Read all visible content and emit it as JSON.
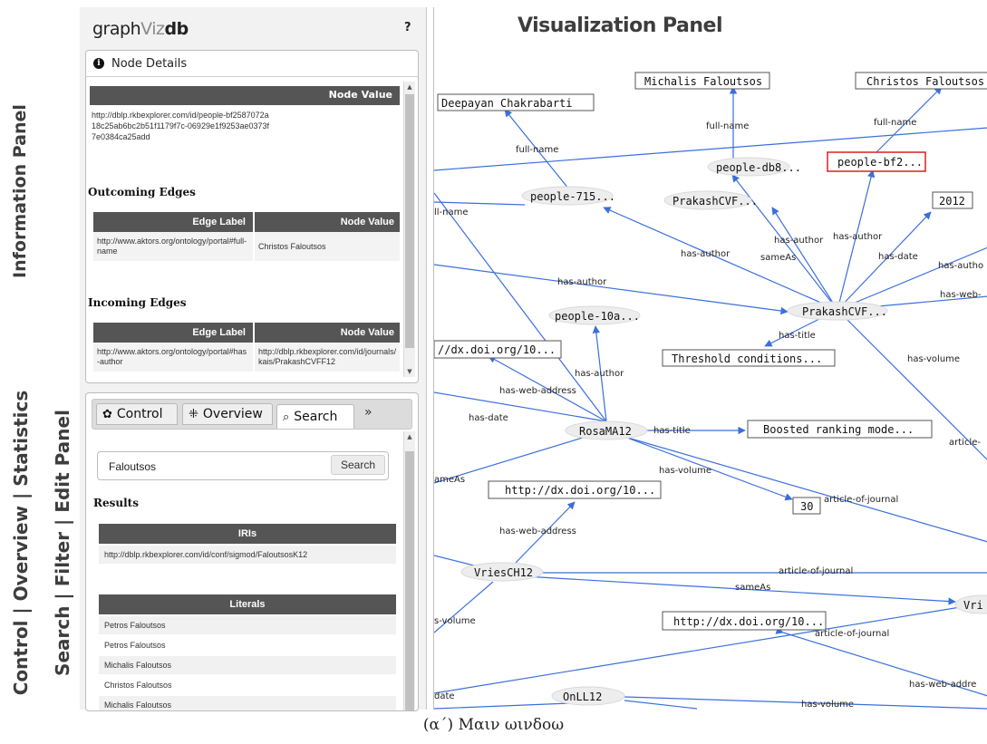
{
  "side_labels": {
    "information": "Information Panel",
    "control_line1": "Control | Overview | Statistics",
    "control_line2": "Search | Filter | Edit Panel"
  },
  "logo": {
    "part1": "graph",
    "part2": "Viz",
    "part3": "db"
  },
  "help": "?",
  "node_details": {
    "title": "Node Details",
    "node_value_header": "Node Value",
    "node_value": "http://dblp.rkbexplorer.com/id/people-bf2587072a18c25ab6bc2b51f1179f7c-06929e1f9253ae0373f7e0384ca25add",
    "outgoing_title": "Outcoming Edges",
    "incoming_title": "Incoming Edges",
    "edge_label_header": "Edge Label",
    "value_header": "Node Value",
    "outgoing": [
      {
        "label": "http://www.aktors.org/ontology/portal#full-name",
        "value": "Christos Faloutsos"
      }
    ],
    "incoming": [
      {
        "label": "http://www.aktors.org/ontology/portal#has-author",
        "value": "http://dblp.rkbexplorer.com/id/journals/kais/PrakashCVFF12"
      }
    ]
  },
  "control": {
    "tabs": [
      {
        "label": "Control",
        "icon": "gear-icon"
      },
      {
        "label": "Overview",
        "icon": "overview-icon"
      },
      {
        "label": "Search",
        "icon": "search-icon"
      }
    ],
    "more": "»",
    "search_value": "Faloutsos",
    "search_button": "Search",
    "results_title": "Results",
    "iris_header": "IRIs",
    "iris": [
      "http://dblp.rkbexplorer.com/id/conf/sigmod/FaloutsosK12"
    ],
    "literals_header": "Literals",
    "literals": [
      "Petros Faloutsos",
      "Petros Faloutsos",
      "Michalis Faloutsos",
      "Christos Faloutsos",
      "Michalis Faloutsos"
    ]
  },
  "viz": {
    "title": "Visualization Panel",
    "nodes": {
      "michalis": "Michalis Faloutsos",
      "christos": "Christos Faloutsos",
      "deepayan": "Deepayan Chakrabarti",
      "people_db8": "people-db8...",
      "people_bf2": "people-bf2...",
      "people_715": "people-715...",
      "prakash_top": "PrakashCVF...",
      "year": "2012",
      "people_10a": "people-10a...",
      "prakash_main": "PrakashCVF...",
      "doi_left": "//dx.doi.org/10...",
      "threshold": "Threshold conditions...",
      "rosa": "RosaMA12",
      "boosted": "Boosted ranking mode...",
      "doi_mid": "http://dx.doi.org/10...",
      "thirty": "30",
      "vries": "VriesCH12",
      "vri_right": "Vri",
      "doi_low": "http://dx.doi.org/10...",
      "onll": "OnLL12"
    },
    "edges": {
      "fn1": "full-name",
      "fn2": "full-name",
      "fn3": "full-name",
      "fn4": "ll-name",
      "ha1": "has-author",
      "ha2": "has-author",
      "ha3": "has-author",
      "ha4": "has-author",
      "ha5": "has-autho",
      "ha6": "has-author",
      "same1": "sameAs",
      "hd1": "has-date",
      "hweb1": "has-web-",
      "htitle1": "has-title",
      "hvol1": "has-volume",
      "hweb2": "has-web-address",
      "hd2": "has-date",
      "htitle2": "has-title",
      "hvol2": "has-volume",
      "same2": "ameAs",
      "art1": "article-of-journal",
      "art2": "article-",
      "hweb3": "has-web-address",
      "art3": "article-of-journal",
      "same3": "sameAs",
      "vol3": "s-volume",
      "art4": "article-of-journal",
      "date3": "date",
      "hweb4": "has-web-addre",
      "hvol4": "has-volume"
    }
  },
  "caption": "(α΄) Μαιν ωινδοω"
}
